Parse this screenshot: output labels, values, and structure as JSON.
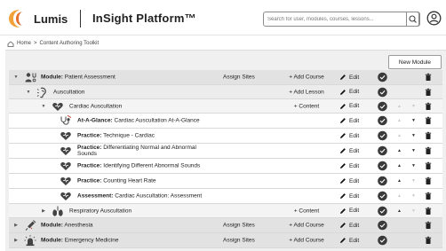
{
  "header": {
    "brand": "Lumis",
    "product": "InSight Platform™",
    "search_placeholder": "Search for user, modules, courses, lessons..."
  },
  "breadcrumb": {
    "home": "Home",
    "sep": ">",
    "current": "Content Authoring Toolkit"
  },
  "actions": {
    "new_module": "New Module"
  },
  "rows": [
    {
      "level": 0,
      "caret": "▼",
      "icon": "stethoscope-person-icon",
      "prefix": "Module:",
      "title": "Patient Assessment",
      "assign": "Assign Sites",
      "add": "+ Add Course",
      "edit": "Edit",
      "up": false,
      "down": false
    },
    {
      "level": 1,
      "caret": "▼",
      "icon": "ear-sound-icon",
      "prefix": "",
      "title": "Auscultation",
      "assign": "",
      "add": "+ Add Lesson",
      "edit": "Edit",
      "up": false,
      "down": false
    },
    {
      "level": 2,
      "caret": "▼",
      "icon": "heart-icon",
      "prefix": "",
      "title": "Cardiac Auscultation",
      "assign": "",
      "add": "+ Content",
      "edit": "Edit",
      "up": false,
      "down": false
    },
    {
      "level": 3,
      "caret": "",
      "icon": "stethoscope-icon",
      "prefix": "At-A-Glance:",
      "title": "Cardiac Auscultation At-A-Glance",
      "assign": "",
      "add": "",
      "edit": "Edit",
      "up": false,
      "down": true
    },
    {
      "level": 3,
      "caret": "",
      "icon": "heart-icon",
      "prefix": "Practice:",
      "title": "Technique - Cardiac",
      "assign": "",
      "add": "",
      "edit": "Edit",
      "up": false,
      "down": true
    },
    {
      "level": 3,
      "caret": "",
      "icon": "heart-icon",
      "prefix": "Practice:",
      "title": "Differentiating Normal and Abnormal Sounds",
      "assign": "",
      "add": "",
      "edit": "Edit",
      "up": true,
      "down": true
    },
    {
      "level": 3,
      "caret": "",
      "icon": "heart-icon",
      "prefix": "Practice:",
      "title": "Identifying Different Abnormal Sounds",
      "assign": "",
      "add": "",
      "edit": "Edit",
      "up": true,
      "down": true
    },
    {
      "level": 3,
      "caret": "",
      "icon": "heart-icon",
      "prefix": "Practice:",
      "title": "Counting Heart Rate",
      "assign": "",
      "add": "",
      "edit": "Edit",
      "up": true,
      "down": false
    },
    {
      "level": 3,
      "caret": "",
      "icon": "heart-icon",
      "prefix": "Assessment:",
      "title": "Cardiac Auscultation: Assessment",
      "assign": "",
      "add": "",
      "edit": "Edit",
      "up": false,
      "down": false
    },
    {
      "level": 2,
      "caret": "▶",
      "icon": "lungs-icon",
      "prefix": "",
      "title": "Respiratory Auscultation",
      "assign": "",
      "add": "+ Content",
      "edit": "Edit",
      "up": true,
      "down": false
    },
    {
      "level": 0,
      "caret": "▶",
      "icon": "syringe-icon",
      "prefix": "Module:",
      "title": "Anesthesia",
      "assign": "Assign Sites",
      "add": "+ Add Course",
      "edit": "Edit",
      "up": false,
      "down": false
    },
    {
      "level": 0,
      "caret": "▶",
      "icon": "emergency-light-icon",
      "prefix": "Module:",
      "title": "Emergency Medicine",
      "assign": "Assign Sites",
      "add": "+ Add Course",
      "edit": "Edit",
      "up": false,
      "down": false
    }
  ]
}
